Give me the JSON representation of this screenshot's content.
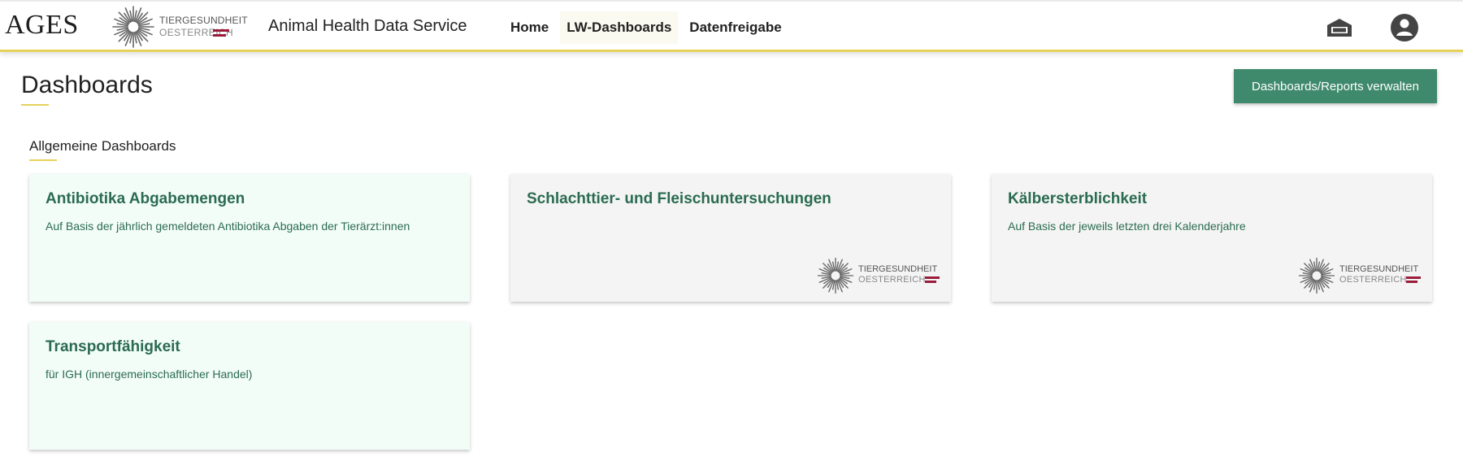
{
  "header": {
    "brand": "AGES",
    "partner_logo": {
      "line1": "TIERGESUNDHEIT",
      "line2": "OESTERREICH"
    },
    "app_title": "Animal Health Data Service",
    "nav": [
      {
        "label": "Home",
        "active": false
      },
      {
        "label": "LW-Dashboards",
        "active": true
      },
      {
        "label": "Datenfreigabe",
        "active": false
      }
    ],
    "icons": [
      "farm-icon",
      "account-icon"
    ]
  },
  "page": {
    "title": "Dashboards",
    "manage_button": "Dashboards/Reports verwalten",
    "section_title": "Allgemeine Dashboards"
  },
  "cards": [
    {
      "title": "Antibiotika Abgabemengen",
      "description": "Auf Basis der jährlich gemeldeten Antibiotika Abgaben der Tierärzt:innen",
      "logo": false
    },
    {
      "title": "Schlachttier- und Fleischuntersuchungen",
      "description": "",
      "logo": true
    },
    {
      "title": "Kälbersterblichkeit",
      "description": "Auf Basis der jeweils letzten drei Kalenderjahre",
      "logo": true
    },
    {
      "title": "Transportfähigkeit",
      "description": "für IGH (innergemeinschaftlicher Handel)",
      "logo": false
    }
  ],
  "card_logo": {
    "line1": "TIERGESUNDHEIT",
    "line2": "OESTERREICH"
  },
  "colors": {
    "accent_yellow": "#e6d25a",
    "primary_green": "#3f8a6c",
    "card_text_green": "#2b6b52",
    "logo_red": "#9b1c3a"
  }
}
